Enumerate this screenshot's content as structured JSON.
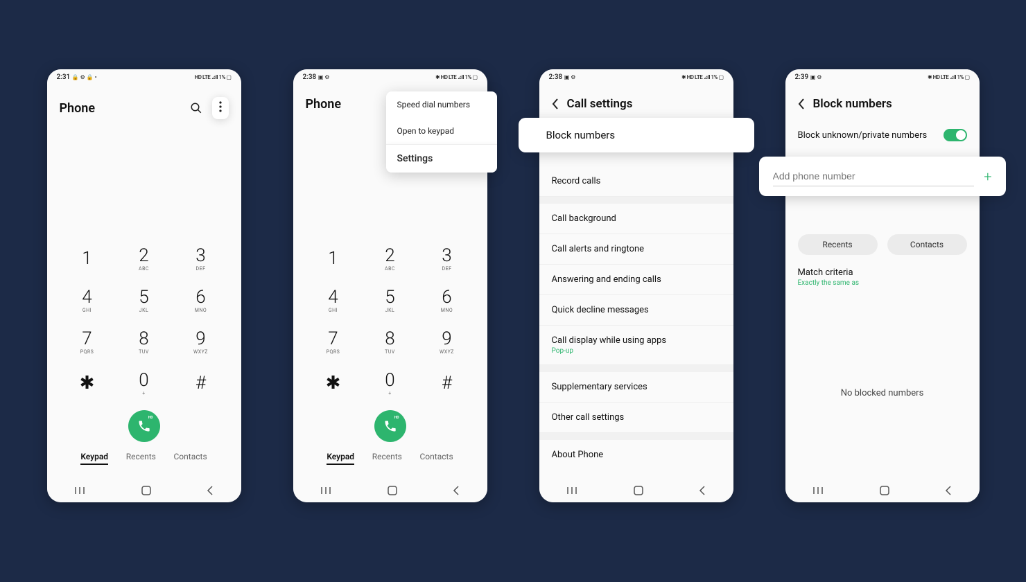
{
  "screens": {
    "s1": {
      "time": "2:31",
      "status_left_icons": "🔒 ⚙ 🔒 •",
      "status_right": "HD LTE ⊿ll 1% ▢",
      "title": "Phone",
      "tabs": [
        "Keypad",
        "Recents",
        "Contacts"
      ],
      "active_tab": "Keypad"
    },
    "s2": {
      "time": "2:38",
      "status_left_icons": "▣ ⚙",
      "status_right": "✱ HD LTE ⊿ll 1% ▢",
      "title": "Phone",
      "menu": [
        "Speed dial numbers",
        "Open to keypad",
        "Settings"
      ],
      "tabs": [
        "Keypad",
        "Recents",
        "Contacts"
      ],
      "active_tab": "Keypad"
    },
    "s3": {
      "time": "2:38",
      "status_left_icons": "▣ ⚙",
      "status_right": "✱ HD LTE ⊿ll 1% ▢",
      "page_title": "Call settings",
      "highlight": "Block numbers",
      "items": [
        {
          "label": "Record calls"
        },
        {
          "label": "Call background"
        },
        {
          "label": "Call alerts and ringtone"
        },
        {
          "label": "Answering and ending calls"
        },
        {
          "label": "Quick decline messages"
        },
        {
          "label": "Call display while using apps",
          "sub": "Pop-up"
        }
      ],
      "items2": [
        {
          "label": "Supplementary services"
        },
        {
          "label": "Other call settings"
        }
      ],
      "items3": [
        {
          "label": "About Phone"
        }
      ]
    },
    "s4": {
      "time": "2:39",
      "status_left_icons": "▣ ⚙",
      "status_right": "✱ HD LTE ⊿ll 1% ▢",
      "page_title": "Block numbers",
      "toggle_label": "Block unknown/private numbers",
      "toggle_on": true,
      "input_placeholder": "Add phone number",
      "chips": [
        "Recents",
        "Contacts"
      ],
      "match_label": "Match criteria",
      "match_sub": "Exactly the same as",
      "empty": "No blocked numbers"
    }
  },
  "keypad": [
    {
      "n": "1",
      "s": ""
    },
    {
      "n": "2",
      "s": "ABC"
    },
    {
      "n": "3",
      "s": "DEF"
    },
    {
      "n": "4",
      "s": "GHI"
    },
    {
      "n": "5",
      "s": "JKL"
    },
    {
      "n": "6",
      "s": "MNO"
    },
    {
      "n": "7",
      "s": "PQRS"
    },
    {
      "n": "8",
      "s": "TUV"
    },
    {
      "n": "9",
      "s": "WXYZ"
    },
    {
      "n": "✱",
      "s": ""
    },
    {
      "n": "0",
      "s": "+"
    },
    {
      "n": "#",
      "s": ""
    }
  ],
  "hd_label": "HD"
}
